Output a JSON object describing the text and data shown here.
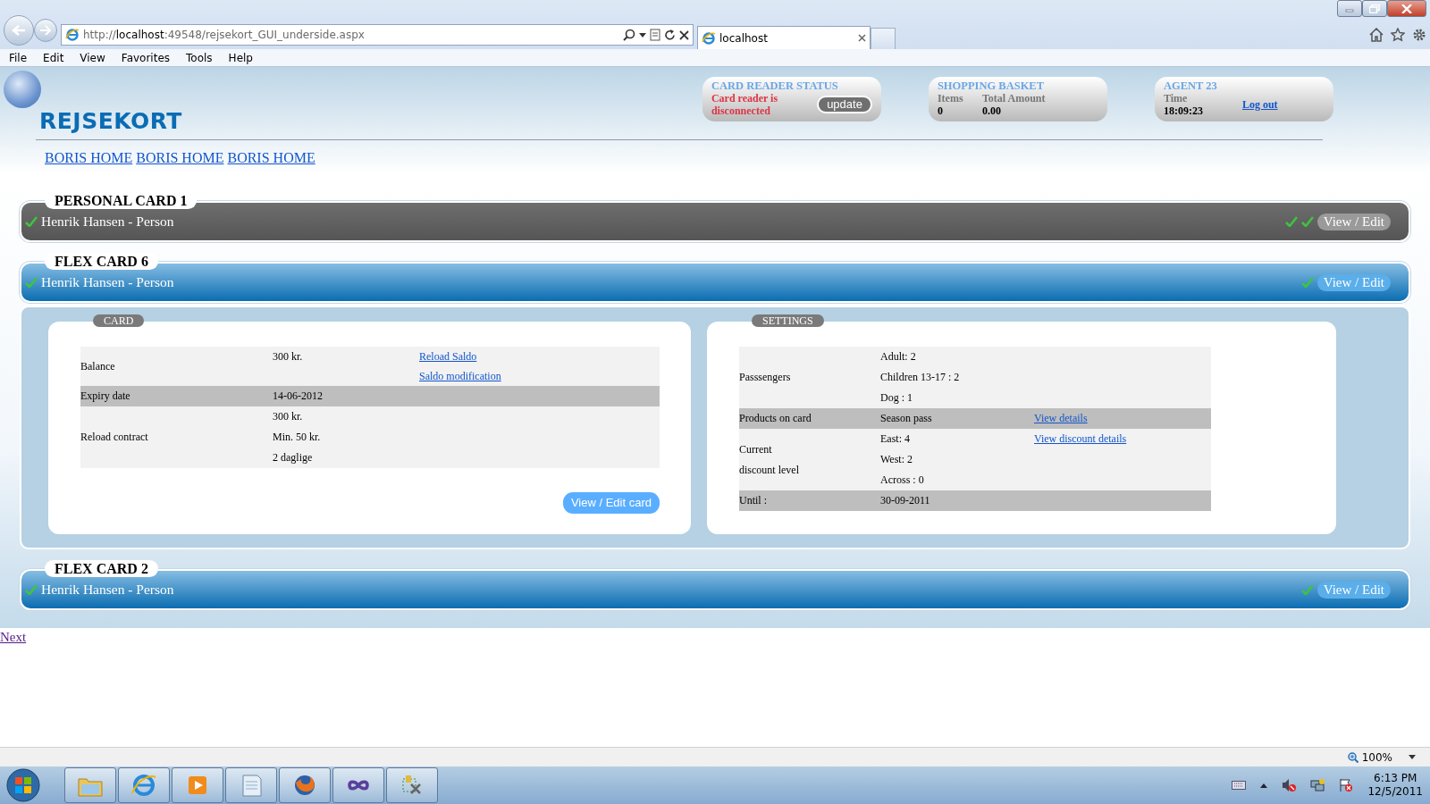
{
  "browser": {
    "url": "http://**localhost**:49548/rejsekort_GUI_underside.aspx",
    "tab_title": "localhost",
    "menu": [
      "File",
      "Edit",
      "View",
      "Favorites",
      "Tools",
      "Help"
    ]
  },
  "header": {
    "logo": "REJSEKORT",
    "card_reader": {
      "title": "CARD READER STATUS",
      "message": "Card reader is disconnected",
      "button": "update"
    },
    "basket": {
      "title": "SHOPPING BASKET",
      "items_label": "Items",
      "items": "0",
      "total_label": "Total Amount",
      "total": "0.00"
    },
    "agent": {
      "title": "AGENT 23",
      "time_label": "Time",
      "time": "18:09:23",
      "logout": "Log out"
    }
  },
  "nav_links": [
    "BORIS HOME",
    "BORIS HOME",
    "BORIS HOME"
  ],
  "cards": [
    {
      "kind": "personal",
      "title": "PERSONAL CARD 1",
      "holder": "Henrik Hansen - Person",
      "indicators": [
        {
          "kind": "check"
        },
        {
          "kind": "check"
        }
      ],
      "button": "View / Edit"
    },
    {
      "kind": "flex",
      "title": "FLEX CARD 6",
      "holder": "Henrik Hansen - Person",
      "indicators": [
        {
          "kind": "check"
        }
      ],
      "button": "View / Edit",
      "expanded": true,
      "details": [
        {
          "title": "CARD",
          "rows": [
            {
              "label": [
                "Balance"
              ],
              "values": [
                "300 kr."
              ],
              "links": [
                "Reload Saldo",
                "Saldo modification"
              ]
            },
            {
              "label": [
                "Expiry date"
              ],
              "values": [
                "14-06-2012"
              ],
              "links": []
            },
            {
              "label": [
                "Reload contract"
              ],
              "values": [
                "300 kr.",
                "Min. 50 kr.",
                "2 daglige"
              ],
              "links": []
            }
          ],
          "button": "View / Edit card"
        },
        {
          "title": "SETTINGS",
          "rows": [
            {
              "label": [
                "Passsengers"
              ],
              "values": [
                "Adult: 2",
                "Children 13-17 : 2",
                "Dog : 1"
              ],
              "links": []
            },
            {
              "label": [
                "Products on card"
              ],
              "values": [
                "Season pass"
              ],
              "links": [
                "View details"
              ]
            },
            {
              "label": [
                "Current",
                "discount level"
              ],
              "values": [
                "East: 4",
                "West: 2",
                "Across : 0"
              ],
              "links": [
                "View discount details"
              ]
            },
            {
              "label": [
                "Until :"
              ],
              "values": [
                "30-09-2011"
              ],
              "links": []
            }
          ]
        }
      ]
    },
    {
      "kind": "flex",
      "title": "FLEX CARD 2",
      "holder": "Henrik Hansen - Person",
      "indicators": [
        {
          "kind": "check"
        }
      ],
      "button": "View / Edit"
    }
  ],
  "next_link": "Next",
  "status_bar": {
    "zoom": "100%"
  },
  "taskbar": {
    "apps": [
      {
        "kind": "folder"
      },
      {
        "kind": "browser"
      },
      {
        "kind": "media"
      },
      {
        "kind": "notepad"
      },
      {
        "kind": "firefox"
      },
      {
        "kind": "infinity"
      },
      {
        "kind": "tools"
      }
    ],
    "clock": {
      "time": "6:13 PM",
      "date": "12/5/2011"
    }
  }
}
